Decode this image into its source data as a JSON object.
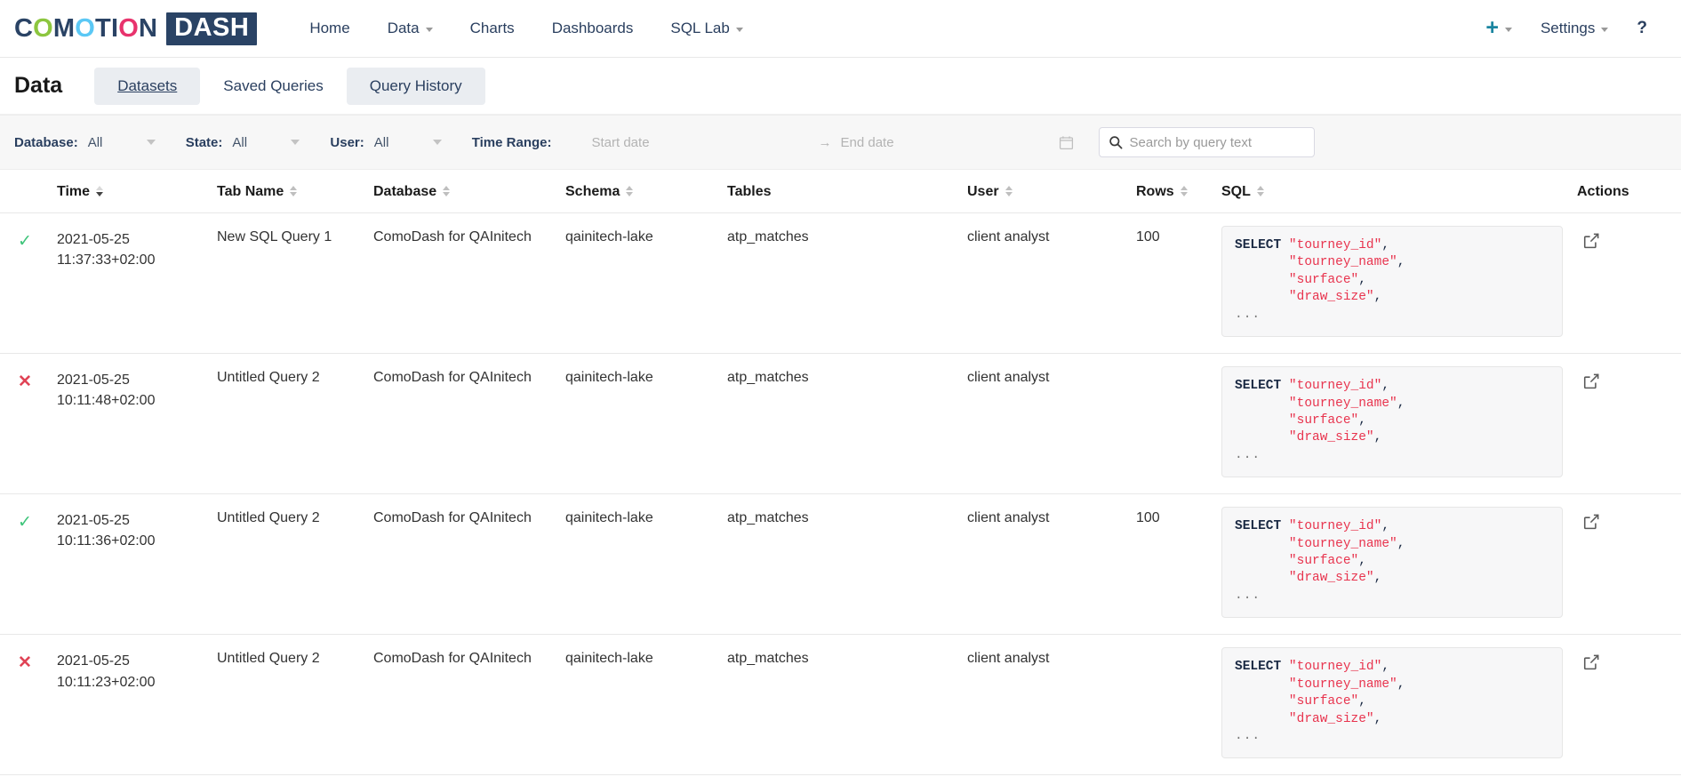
{
  "brand": {
    "word1_parts": [
      {
        "t": "C",
        "c": "navy"
      },
      {
        "t": "O",
        "c": "green"
      },
      {
        "t": "M",
        "c": "navy"
      },
      {
        "t": "O",
        "c": "cyan"
      },
      {
        "t": "T",
        "c": "navy"
      },
      {
        "t": "I",
        "c": "navy"
      },
      {
        "t": "O",
        "c": "pink"
      },
      {
        "t": "N",
        "c": "navy"
      }
    ],
    "word2": "DASH",
    "colors": {
      "navy": "#2a4365",
      "green": "#8cc63f",
      "cyan": "#5bc8f5",
      "pink": "#e8336d"
    }
  },
  "topnav": {
    "links": [
      {
        "label": "Home",
        "has_caret": false
      },
      {
        "label": "Data",
        "has_caret": true
      },
      {
        "label": "Charts",
        "has_caret": false
      },
      {
        "label": "Dashboards",
        "has_caret": false
      },
      {
        "label": "SQL Lab",
        "has_caret": true
      }
    ],
    "plus_icon": "plus-icon",
    "plus_glyph": "+",
    "settings_label": "Settings",
    "help_glyph": "?",
    "accent_color": "#1a85a0"
  },
  "page": {
    "title": "Data",
    "tabs": [
      {
        "label": "Datasets",
        "style": "chip-underline"
      },
      {
        "label": "Saved Queries",
        "style": "plain"
      },
      {
        "label": "Query History",
        "style": "chip"
      }
    ]
  },
  "filters": {
    "database": {
      "label": "Database:",
      "value": "All"
    },
    "state": {
      "label": "State:",
      "value": "All"
    },
    "user": {
      "label": "User:",
      "value": "All"
    },
    "time_range": {
      "label": "Time Range:",
      "start_placeholder": "Start date",
      "end_placeholder": "End date",
      "separator": "→",
      "calendar_icon": "calendar-icon"
    },
    "search": {
      "placeholder": "Search by query text",
      "icon": "search-icon",
      "value": ""
    }
  },
  "table": {
    "columns": [
      {
        "key": "status",
        "label": "",
        "sortable": false
      },
      {
        "key": "time",
        "label": "Time",
        "sortable": true,
        "sort": "desc"
      },
      {
        "key": "tab",
        "label": "Tab Name",
        "sortable": true
      },
      {
        "key": "db",
        "label": "Database",
        "sortable": true
      },
      {
        "key": "schema",
        "label": "Schema",
        "sortable": true
      },
      {
        "key": "tables",
        "label": "Tables",
        "sortable": false
      },
      {
        "key": "user",
        "label": "User",
        "sortable": true
      },
      {
        "key": "rows",
        "label": "Rows",
        "sortable": true
      },
      {
        "key": "sql",
        "label": "SQL",
        "sortable": true
      },
      {
        "key": "actions",
        "label": "Actions",
        "sortable": false
      }
    ],
    "status_icons": {
      "success": "✓",
      "failed": "✕"
    },
    "action_icon": "external-link-icon",
    "sql_snippet": {
      "keyword": "SELECT",
      "columns": [
        "\"tourney_id\"",
        "\"tourney_name\"",
        "\"surface\"",
        "\"draw_size\""
      ],
      "ellipsis": "..."
    },
    "rows": [
      {
        "status": "success",
        "time_date": "2021-05-25",
        "time_clock": "11:37:33+02:00",
        "tab": "New SQL Query 1",
        "db": "ComoDash for QAInitech",
        "schema": "qainitech-lake",
        "tables": "atp_matches",
        "user": "client analyst",
        "rows": "100"
      },
      {
        "status": "failed",
        "time_date": "2021-05-25",
        "time_clock": "10:11:48+02:00",
        "tab": "Untitled Query 2",
        "db": "ComoDash for QAInitech",
        "schema": "qainitech-lake",
        "tables": "atp_matches",
        "user": "client analyst",
        "rows": ""
      },
      {
        "status": "success",
        "time_date": "2021-05-25",
        "time_clock": "10:11:36+02:00",
        "tab": "Untitled Query 2",
        "db": "ComoDash for QAInitech",
        "schema": "qainitech-lake",
        "tables": "atp_matches",
        "user": "client analyst",
        "rows": "100"
      },
      {
        "status": "failed",
        "time_date": "2021-05-25",
        "time_clock": "10:11:23+02:00",
        "tab": "Untitled Query 2",
        "db": "ComoDash for QAInitech",
        "schema": "qainitech-lake",
        "tables": "atp_matches",
        "user": "client analyst",
        "rows": ""
      }
    ]
  }
}
